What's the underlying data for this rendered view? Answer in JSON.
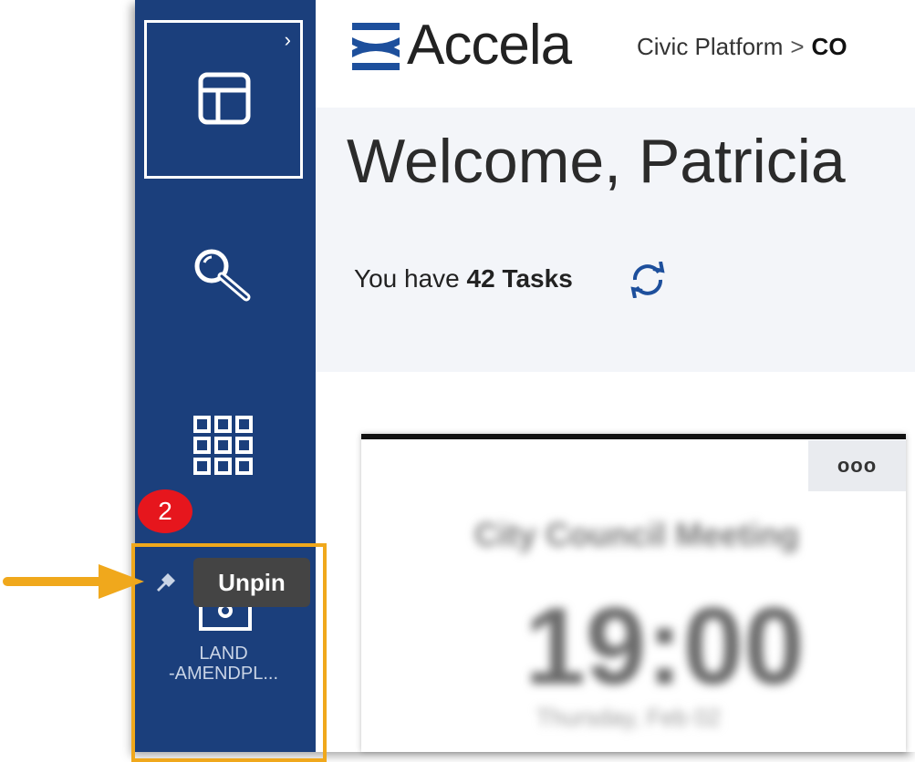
{
  "sidebar": {
    "expand_icon": "chevron-right-icon",
    "home_icon": "dashboard-layout-icon",
    "search_icon": "search-icon",
    "apps_icon": "app-grid-icon",
    "pinned_item": {
      "icon": "pin-icon",
      "label_line1": "LAND",
      "label_line2": "-AMENDPL..."
    }
  },
  "annotation": {
    "badge": "2",
    "tooltip": "Unpin",
    "arrow_color": "#f0a81c",
    "highlight_color": "#f0a81c"
  },
  "header": {
    "logo_text": "Accela",
    "breadcrumb_root": "Civic Platform",
    "breadcrumb_sep": ">",
    "breadcrumb_current": "CO"
  },
  "welcome": {
    "title": "Welcome, Patricia",
    "tasks_prefix": "You have",
    "tasks_count": "42 Tasks"
  },
  "card": {
    "menu_label": "ooo",
    "event_title": "City Council Meeting",
    "event_time": "19:00",
    "event_date": "Thursday, Feb 02"
  },
  "colors": {
    "sidebar_bg": "#1b3f7c",
    "accent_blue": "#1d4f9c",
    "badge_red": "#e6161d",
    "welcome_bg": "#f3f5f9"
  }
}
